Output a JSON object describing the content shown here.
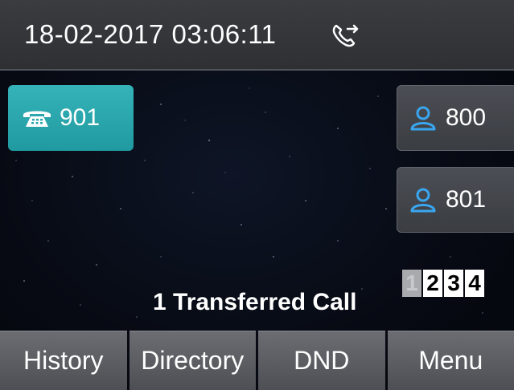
{
  "status_bar": {
    "datetime": "18-02-2017 03:06:11",
    "status_icon": "call-forward-icon"
  },
  "line_keys": {
    "left": {
      "label": "901",
      "icon": "phone-icon",
      "color": "#27a7ad"
    },
    "right": [
      {
        "label": "800",
        "icon": "user-icon",
        "icon_color": "#3aa6f0"
      },
      {
        "label": "801",
        "icon": "user-icon",
        "icon_color": "#3aa6f0"
      }
    ]
  },
  "pager": {
    "pages": [
      "1",
      "2",
      "3",
      "4"
    ],
    "active": "1"
  },
  "notice": "1 Transferred Call",
  "softkeys": [
    "History",
    "Directory",
    "DND",
    "Menu"
  ]
}
